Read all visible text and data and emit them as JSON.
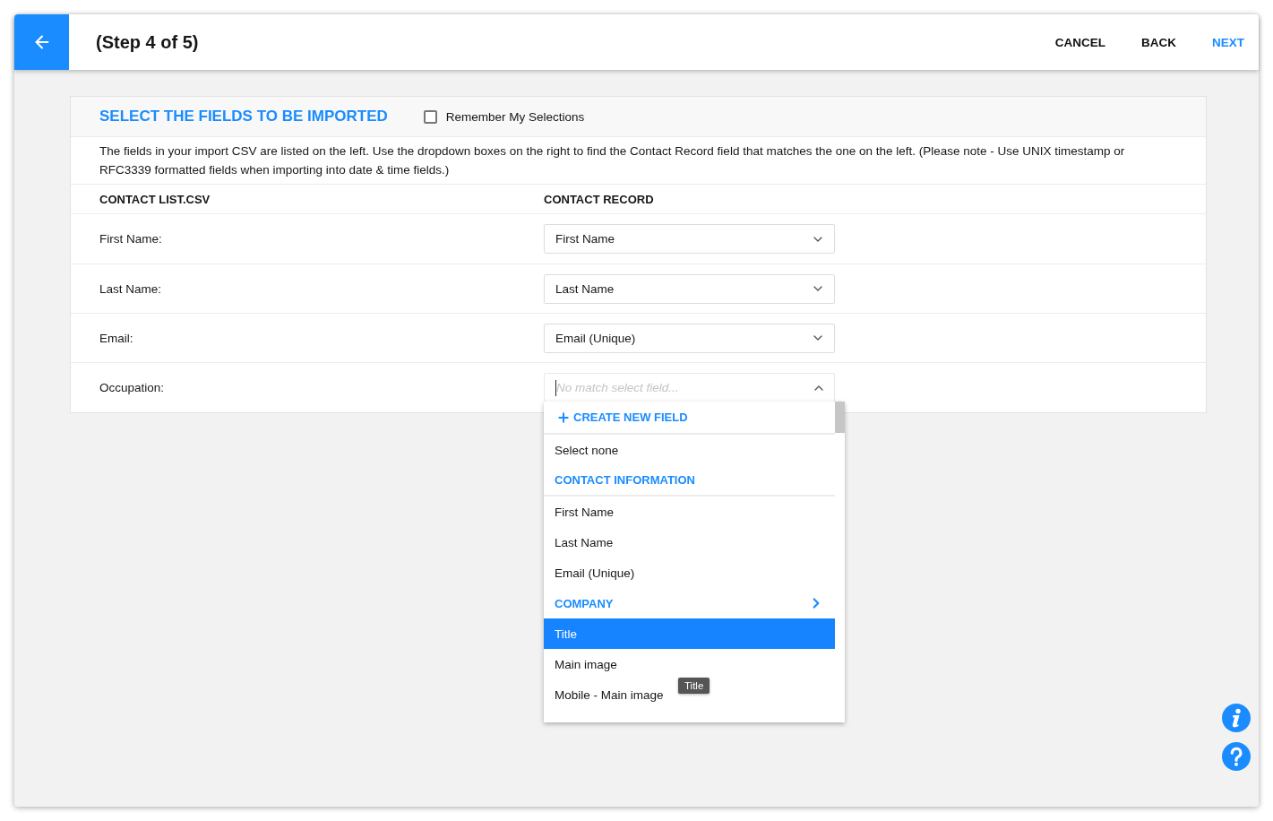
{
  "header": {
    "title": "(Step 4 of 5)",
    "actions": [
      {
        "label": "CANCEL",
        "primary": false
      },
      {
        "label": "BACK",
        "primary": false
      },
      {
        "label": "NEXT",
        "primary": true
      }
    ]
  },
  "panel": {
    "title": "SELECT THE FIELDS TO BE IMPORTED",
    "remember": {
      "label": "Remember My Selections",
      "checked": false
    },
    "description": "The fields in your import CSV are listed on the left. Use the dropdown boxes on the right to find the Contact Record field that matches the one on the left. (Please note - Use UNIX timestamp or RFC3339 formatted fields when importing into date & time fields.)",
    "columns": [
      "CONTACT LIST.CSV",
      "CONTACT RECORD"
    ],
    "rows": [
      {
        "label": "First Name:",
        "value": "First Name",
        "expanded": false
      },
      {
        "label": "Last Name:",
        "value": "Last Name",
        "expanded": false
      },
      {
        "label": "Email:",
        "value": "Email (Unique)",
        "expanded": false
      },
      {
        "label": "Occupation:",
        "placeholder": "No match select field...",
        "expanded": true
      }
    ],
    "dropdown": {
      "create_button": "CREATE NEW FIELD",
      "options": [
        {
          "kind": "option",
          "label": "Select none",
          "selected": false
        },
        {
          "kind": "group",
          "label": "CONTACT INFORMATION"
        },
        {
          "kind": "option",
          "label": "First Name",
          "selected": false
        },
        {
          "kind": "option",
          "label": "Last Name",
          "selected": false
        },
        {
          "kind": "option",
          "label": "Email (Unique)",
          "selected": false
        },
        {
          "kind": "submenu",
          "label": "COMPANY",
          "selected": false
        },
        {
          "kind": "option",
          "label": "Title",
          "selected": true
        },
        {
          "kind": "option",
          "label": "Main image",
          "selected": false
        },
        {
          "kind": "option",
          "label": "Mobile - Main image",
          "selected": false
        }
      ],
      "tooltip": "Title"
    }
  }
}
